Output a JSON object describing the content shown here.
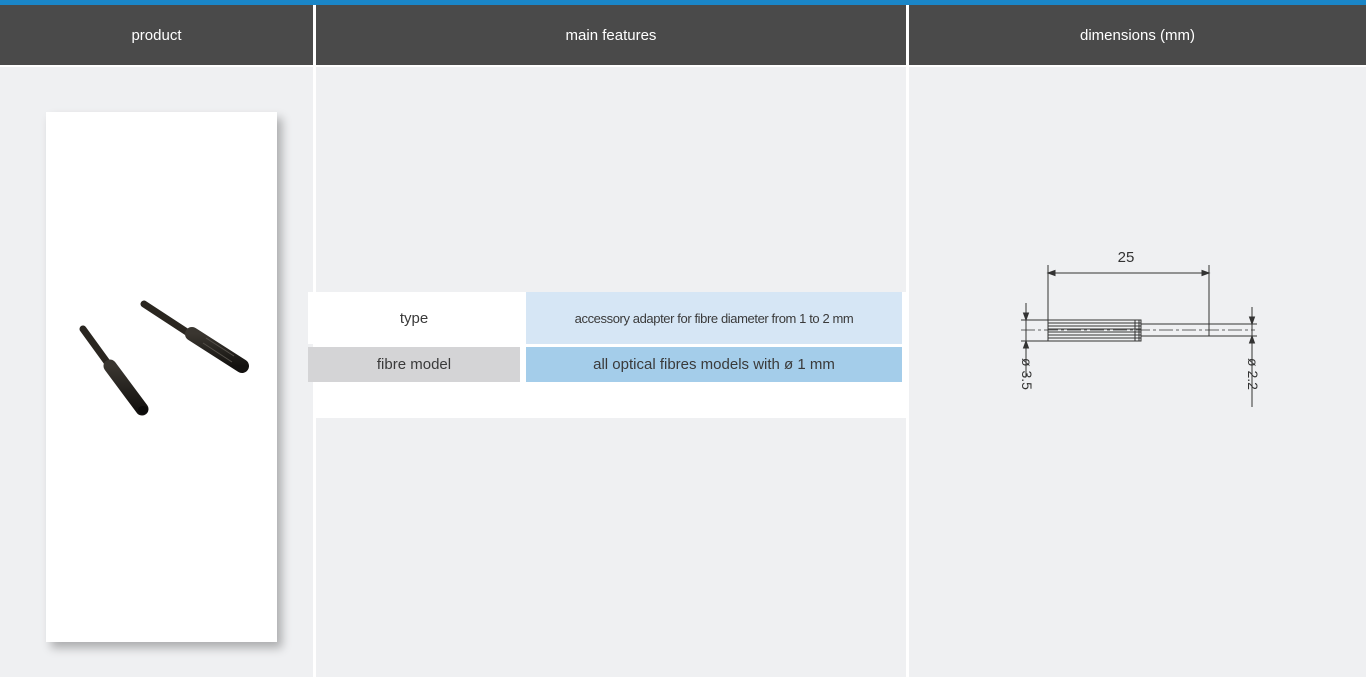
{
  "header": {
    "col_product": "product",
    "col_features": "main features",
    "col_dimensions": "dimensions (mm)"
  },
  "features": {
    "rows": [
      {
        "label": "type",
        "value": "accessory adapter for fibre diameter from 1 to 2 mm"
      },
      {
        "label": "fibre model",
        "value": "all optical fibres models with ø 1 mm"
      }
    ]
  },
  "drawing": {
    "length_label": "25",
    "diameter_left": "ø 3.5",
    "diameter_right": "ø 2.2"
  },
  "colors": {
    "accent": "#1a86c8",
    "header_bg": "#4a4a4a",
    "panel_bg": "#eff0f2",
    "row1_value_bg": "#d6e6f5",
    "row2_label_bg": "#d4d4d6",
    "row2_value_bg": "#a4cdea"
  }
}
